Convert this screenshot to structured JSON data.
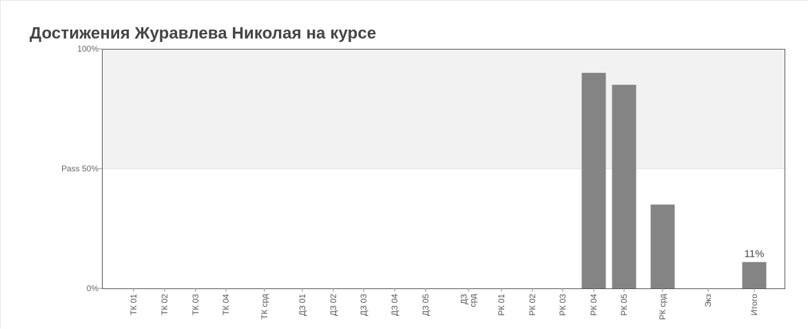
{
  "title": "Достижения Журавлева Николая на курсе",
  "chart_data": {
    "type": "bar",
    "title": "Достижения Журавлева Николая на курсе",
    "categories": [
      [
        "ТК 01"
      ],
      [
        "ТК 02"
      ],
      [
        "ТК 03"
      ],
      [
        "ТК 04"
      ],
      [
        "ТК срд"
      ],
      [
        "ДЗ 01"
      ],
      [
        "ДЗ 02"
      ],
      [
        "ДЗ 03"
      ],
      [
        "ДЗ 04"
      ],
      [
        "ДЗ 05"
      ],
      [
        "ДЗ",
        "срд"
      ],
      [
        "РК 01"
      ],
      [
        "РК 02"
      ],
      [
        "РК 03"
      ],
      [
        "РК 04"
      ],
      [
        "РК 05"
      ],
      [
        "РК срд"
      ],
      [
        "Экз"
      ],
      [
        "Итого"
      ]
    ],
    "values": [
      0,
      0,
      0,
      0,
      0,
      0,
      0,
      0,
      0,
      0,
      0,
      0,
      0,
      0,
      90,
      85,
      35,
      0,
      11
    ],
    "data_labels": {
      "18": "11%"
    },
    "y_ticks": [
      {
        "value": 0,
        "label": "0%"
      },
      {
        "value": 50,
        "label": "Pass 50%"
      },
      {
        "value": 100,
        "label": "100%"
      }
    ],
    "ylim": [
      0,
      100
    ],
    "pass_threshold": 50,
    "colors": {
      "bar": "#848484",
      "pass_zone": "#f2f2f2",
      "frame": "#555555",
      "grid": "#dddddd"
    },
    "xlabel": "",
    "ylabel": ""
  }
}
